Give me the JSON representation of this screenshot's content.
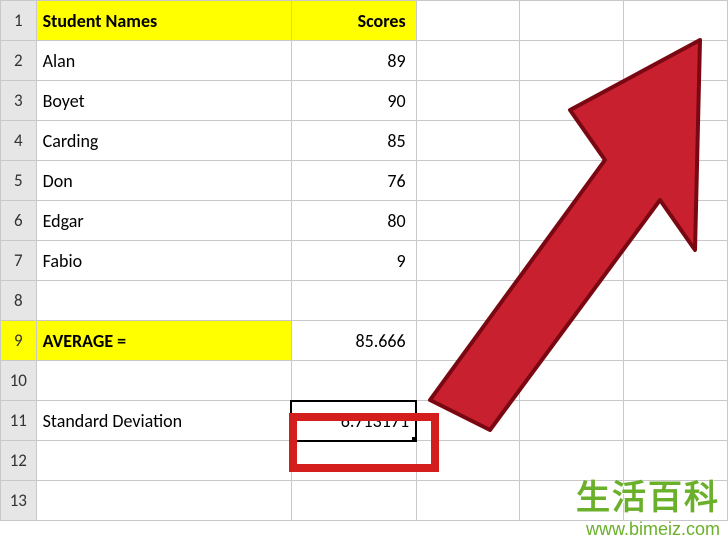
{
  "headers": {
    "col_a": "Student Names",
    "col_b": "Scores"
  },
  "rows": {
    "r1_num": "1",
    "r2_num": "2",
    "r2_name": "Alan",
    "r2_score": "89",
    "r3_num": "3",
    "r3_name": "Boyet",
    "r3_score": "90",
    "r4_num": "4",
    "r4_name": "Carding",
    "r4_score": "85",
    "r5_num": "5",
    "r5_name": "Don",
    "r5_score": "76",
    "r6_num": "6",
    "r6_name": "Edgar",
    "r6_score": "80",
    "r7_num": "7",
    "r7_name": "Fabio",
    "r7_score": "9",
    "r8_num": "8",
    "r9_num": "9",
    "r9_label": "AVERAGE =",
    "r9_value": "85.666",
    "r10_num": "10",
    "r11_num": "11",
    "r11_label": "Standard Deviation",
    "r11_value": "6.713171",
    "r12_num": "12",
    "r13_num": "13"
  },
  "watermark": {
    "text_cn": "生活百科",
    "url": "www.bimeiz.com"
  }
}
